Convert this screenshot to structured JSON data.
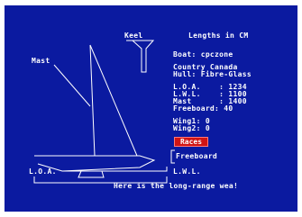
{
  "labels": {
    "keel": "Keel",
    "lengths_title": "Lengths in CM",
    "mast": "Mast",
    "freeboard": "Freeboard",
    "loa": "L.O.A.",
    "lwl": "L.W.L."
  },
  "boat": {
    "name_line": "Boat: cpczone",
    "country_line": "Country Canada",
    "hull_line": "Hull: Fibre-Glass"
  },
  "lengths": [
    {
      "line": "L.O.A.    : 1234"
    },
    {
      "line": "L.W.L.    : 1100"
    },
    {
      "line": "Mast      : 1400"
    },
    {
      "line": "Freeboard: 40"
    }
  ],
  "wings": [
    {
      "line": "Wing1: 0"
    },
    {
      "line": "Wing2: 0"
    }
  ],
  "races_button_label": "Races",
  "status_message": "Here is the long-range wea!",
  "colors": {
    "panel_bg": "#0b1aa0",
    "text": "#ffffff",
    "button_bg": "#d11414"
  }
}
